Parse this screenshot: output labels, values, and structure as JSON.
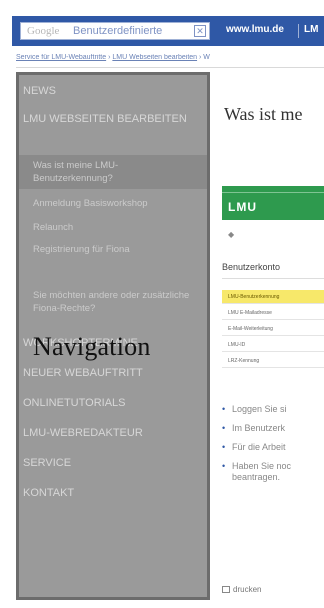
{
  "header": {
    "search_provider": "Google",
    "search_value": "Benutzerdefinierte",
    "site_link": "www.lmu.de",
    "next_label_truncated": "LM"
  },
  "breadcrumb": {
    "items": [
      "Service für LMU-Webauftritte",
      "LMU Webseiten bearbeiten",
      "W"
    ]
  },
  "sidebar": {
    "overlay_label": "Navigation",
    "items": [
      {
        "label": "NEWS"
      },
      {
        "label": "LMU WEBSEITEN BEARBEITEN"
      },
      {
        "label": "Was ist meine LMU-Benutzerkennung?"
      },
      {
        "label": "Anmeldung Basisworkshop"
      },
      {
        "label": "Relaunch"
      },
      {
        "label": "Registrierung für Fiona"
      },
      {
        "label": "Sie möchten andere oder zusätzliche Fiona-Rechte?"
      },
      {
        "label": "WORKSHOPTERMINE"
      },
      {
        "label": "NEUER WEBAUFTRITT"
      },
      {
        "label": "ONLINETUTORIALS"
      },
      {
        "label": "LMU-WEBREDAKTEUR"
      },
      {
        "label": "SERVICE"
      },
      {
        "label": "KONTAKT"
      }
    ]
  },
  "content": {
    "title": "Was ist me",
    "logo_text": "LMU",
    "konto_heading": "Benutzerkonto",
    "menu": [
      "LMU-Benutzerkennung",
      "LMU E-Mailadresse",
      "E-Mail-Weiterleitung",
      "LMU-ID",
      "LRZ-Kennung"
    ],
    "bullets": [
      "Loggen Sie si",
      "Im Benutzerk",
      "Für die Arbeit",
      "Haben Sie noc",
      "beantragen."
    ],
    "print_label": "drucken"
  }
}
